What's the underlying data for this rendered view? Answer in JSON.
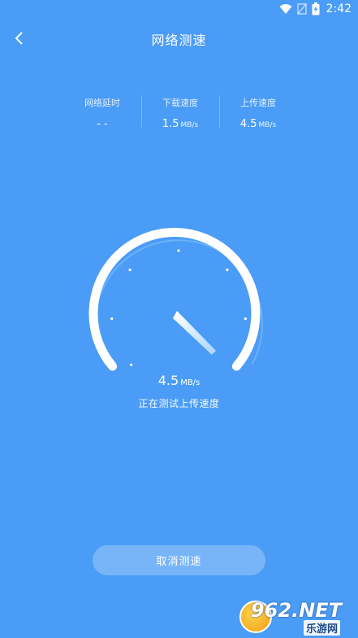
{
  "status_bar": {
    "time": "2:42",
    "icons": [
      "wifi-icon",
      "signal-off-icon",
      "battery-charging-icon"
    ]
  },
  "header": {
    "title": "网络测速",
    "back_icon": "chevron-left-icon"
  },
  "stats": [
    {
      "label": "网络延时",
      "value": "- -",
      "unit": ""
    },
    {
      "label": "下载速度",
      "value": "1.5",
      "unit": "MB/s"
    },
    {
      "label": "上传速度",
      "value": "4.5",
      "unit": "MB/s"
    }
  ],
  "gauge": {
    "value": "4.5",
    "unit": "MB/s",
    "status_text": "正在测试上传速度"
  },
  "cancel_button": {
    "label": "取消测速"
  },
  "watermark": {
    "brand": "962.NET",
    "sub": "乐游网"
  },
  "colors": {
    "background": "#4a9cf6",
    "accent": "#ffffff"
  }
}
